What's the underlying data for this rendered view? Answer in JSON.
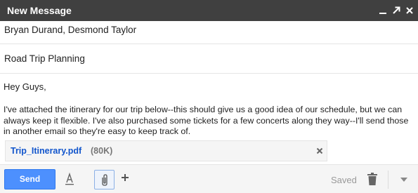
{
  "window": {
    "title": "New Message",
    "controls": [
      "minimize-icon",
      "pop-out-icon",
      "close-icon"
    ]
  },
  "compose": {
    "recipients": "Bryan Durand, Desmond Taylor",
    "subject": "Road Trip Planning",
    "body": {
      "greeting": "Hey Guys,",
      "message": "I've attached the itinerary for our trip below--this should give us a good idea of our schedule, but we can always keep it flexible. I've also purchased some tickets for a few concerts along they way--I'll send those in another email so they're easy to keep track of."
    },
    "attachment": {
      "name": "Trip_Itinerary.pdf",
      "size": "(80K)",
      "remove_icon": "close-icon"
    }
  },
  "toolbar": {
    "send_label": "Send",
    "formatting_icon": "text-format-icon",
    "attach_icon": "paperclip-icon",
    "more_insert_icon": "plus-icon",
    "saved_label": "Saved",
    "discard_icon": "trash-icon",
    "more_options_icon": "chevron-down-icon"
  },
  "colors": {
    "titlebar": "#404040",
    "send_button": "#4d90fe",
    "link": "#1155cc",
    "toolbar_bg": "#f5f5f5"
  }
}
